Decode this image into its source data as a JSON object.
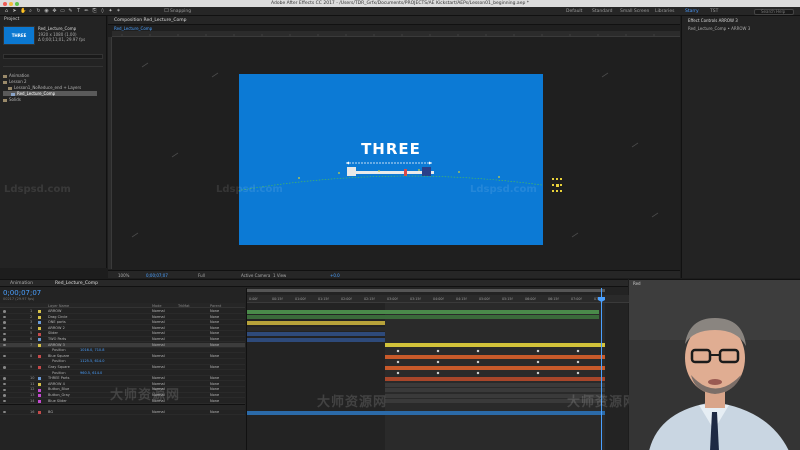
{
  "window": {
    "title": "Adobe After Effects CC 2017 - /Users/TDR_Grfx/Documents/PROJECTS/AE Kickstart/AEPs/Lesson01_beginning.aep *"
  },
  "toolbar": {
    "snapping_label": "Snapping",
    "workspaces": [
      "Default",
      "Standard",
      "Small Screen",
      "Libraries"
    ],
    "active_workspace": "Starry",
    "tst_label": "TST",
    "search_placeholder": "Search Help"
  },
  "project": {
    "tab_label": "Project",
    "comp_name": "Red_Lecture_Comp",
    "info_lines": [
      "1920 x 1080 (1.00)",
      "Δ 0;00;11;01, 29.97 fps"
    ],
    "items": [
      {
        "name": "Animation",
        "type": "folder"
      },
      {
        "name": "Lesson 2",
        "type": "folder"
      },
      {
        "name": "Lesson1_NoReduce_end + Layers",
        "type": "folder"
      },
      {
        "name": "Red_Lecture_Comp",
        "type": "comp",
        "selected": true
      },
      {
        "name": "Solids",
        "type": "folder"
      }
    ]
  },
  "composition": {
    "tab_label": "Composition Red_Lecture_Comp",
    "breadcrumb": "Red_Lecture_Comp",
    "canvas_text": "THREE",
    "canvas_color": "#0c7ad5",
    "footer": {
      "zoom": "100%",
      "timecode": "0;00;07;07",
      "resolution": "Full",
      "camera": "Active Camera",
      "views": "1 View",
      "exposure": "+0.0"
    }
  },
  "effects_panel": {
    "tab_label": "Effect Controls ARROW 3",
    "subtitle": "Red_Lecture_Comp • ARROW 3"
  },
  "timeline": {
    "tabs": [
      "Animation",
      "Red_Lecture_Comp"
    ],
    "timecode": "0;00;07;07",
    "timecode_sub": "00217 (29.97 fps)",
    "headers": {
      "source": "Layer Name",
      "mode": "Mode",
      "trkmat": "TrkMat",
      "parent": "Parent"
    },
    "layers": [
      {
        "num": "1",
        "name": "ARROW",
        "color": "#d6c24a",
        "mode": "Normal",
        "parent": "None"
      },
      {
        "num": "2",
        "name": "Drag Circle",
        "color": "#d6c24a",
        "mode": "Normal",
        "parent": "None"
      },
      {
        "num": "3",
        "name": "ONE parts",
        "color": "#6a9ad6",
        "mode": "Normal",
        "parent": "None"
      },
      {
        "num": "4",
        "name": "ARROW 2",
        "color": "#d6c24a",
        "mode": "Normal",
        "parent": "None"
      },
      {
        "num": "5",
        "name": "Slider",
        "color": "#c44a4a",
        "mode": "Normal",
        "parent": "None"
      },
      {
        "num": "6",
        "name": "TWO Parts",
        "color": "#6a9ad6",
        "mode": "Normal",
        "parent": "None"
      },
      {
        "num": "7",
        "name": "ARROW 3",
        "color": "#d6c24a",
        "mode": "Normal",
        "parent": "None",
        "selected": true
      },
      {
        "num": "",
        "name": "Position",
        "prop": true,
        "value": "1016.0, 710.8"
      },
      {
        "num": "8",
        "name": "Blue Square",
        "color": "#c44a4a",
        "mode": "Normal",
        "parent": "None"
      },
      {
        "num": "",
        "name": "Position",
        "prop": true,
        "value": "1125.5, 614.0"
      },
      {
        "num": "9",
        "name": "Gray Square",
        "color": "#c44a4a",
        "mode": "Normal",
        "parent": "None"
      },
      {
        "num": "",
        "name": "Position",
        "prop": true,
        "value": "960.5, 614.0"
      },
      {
        "num": "10",
        "name": "THREE Parts",
        "color": "#6a9ad6",
        "mode": "Normal",
        "parent": "None"
      },
      {
        "num": "11",
        "name": "ARROW 4",
        "color": "#d6c24a",
        "mode": "Normal",
        "parent": "None"
      },
      {
        "num": "12",
        "name": "Button_Blue",
        "color": "#c44ad0",
        "mode": "Normal",
        "parent": "None"
      },
      {
        "num": "13",
        "name": "Button_Gray",
        "color": "#c44ad0",
        "mode": "Normal",
        "parent": "None"
      },
      {
        "num": "14",
        "name": "Blue Slider",
        "color": "#c44ad0",
        "mode": "Normal",
        "parent": "None"
      },
      {
        "num": "15",
        "name": "FOUR Parts",
        "color": "#6a9ad6",
        "mode": "Normal",
        "parent": "None"
      },
      {
        "num": "16",
        "name": "BG",
        "color": "#c44a4a",
        "mode": "Normal",
        "parent": "None"
      }
    ],
    "ruler_labels": [
      "0:00f",
      "00:15f",
      "01:00f",
      "01:15f",
      "02:00f",
      "02:15f",
      "03:00f",
      "03:15f",
      "04:00f",
      "04:15f",
      "05:00f",
      "05:15f",
      "06:00f",
      "06:15f",
      "07:00f",
      "07:15f"
    ]
  },
  "webcam": {
    "label": "Red"
  },
  "watermarks": {
    "text": "Ldspsd.com",
    "cn_text": "大师资源网"
  }
}
